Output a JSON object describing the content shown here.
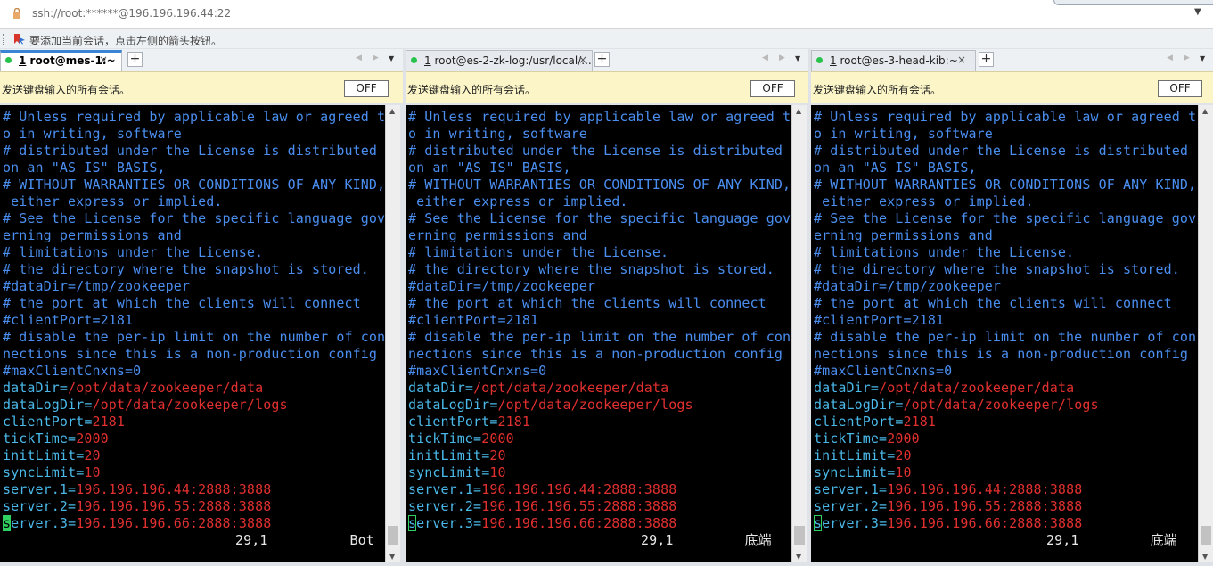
{
  "address_bar": {
    "url": "ssh://root:******@196.196.196.44:22"
  },
  "hint_bar": {
    "text": "要添加当前会话，点击左侧的箭头按钮。"
  },
  "panes": [
    {
      "tab": {
        "number": "1",
        "title": "root@mes-1:~",
        "active": true
      },
      "send_bar": {
        "text": "发送键盘输入的所有会话。",
        "toggle_label": "OFF"
      },
      "status": {
        "position": "29,1",
        "scroll": "Bot"
      },
      "cursor_style": "solid"
    },
    {
      "tab": {
        "number": "1",
        "title": "root@es-2-zk-log:/usr/local/...",
        "active": false
      },
      "send_bar": {
        "text": "发送键盘输入的所有会话。",
        "toggle_label": "OFF"
      },
      "status": {
        "position": "29,1",
        "scroll": "底端"
      },
      "cursor_style": "hollow"
    },
    {
      "tab": {
        "number": "1",
        "title": "root@es-3-head-kib:~",
        "active": false
      },
      "send_bar": {
        "text": "发送键盘输入的所有会话。",
        "toggle_label": "OFF"
      },
      "status": {
        "position": "29,1",
        "scroll": "底端"
      },
      "cursor_style": "hollow"
    }
  ],
  "terminal_lines": [
    [
      {
        "t": "# Unless required by applicable law or agreed t",
        "c": "blue"
      }
    ],
    [
      {
        "t": "o in writing, software",
        "c": "blue"
      }
    ],
    [
      {
        "t": "# distributed under the License is distributed",
        "c": "blue"
      }
    ],
    [
      {
        "t": "on an \"AS IS\" BASIS,",
        "c": "blue"
      }
    ],
    [
      {
        "t": "# WITHOUT WARRANTIES OR CONDITIONS OF ANY KIND,",
        "c": "blue"
      }
    ],
    [
      {
        "t": " either express or implied.",
        "c": "blue"
      }
    ],
    [
      {
        "t": "# See the License for the specific language gov",
        "c": "blue"
      }
    ],
    [
      {
        "t": "erning permissions and",
        "c": "blue"
      }
    ],
    [
      {
        "t": "# limitations under the License.",
        "c": "blue"
      }
    ],
    [
      {
        "t": "# the directory where the snapshot is stored.",
        "c": "blue"
      }
    ],
    [
      {
        "t": "#dataDir=/tmp/zookeeper",
        "c": "blue"
      }
    ],
    [
      {
        "t": "# the port at which the clients will connect",
        "c": "blue"
      }
    ],
    [
      {
        "t": "#clientPort=2181",
        "c": "blue"
      }
    ],
    [
      {
        "t": "# disable the per-ip limit on the number of con",
        "c": "blue"
      }
    ],
    [
      {
        "t": "nections since this is a non-production config",
        "c": "blue"
      }
    ],
    [
      {
        "t": "#maxClientCnxns=0",
        "c": "blue"
      }
    ],
    [
      {
        "t": "dataDir",
        "c": "cyan"
      },
      {
        "t": "=",
        "c": "cyan"
      },
      {
        "t": "/opt/data/zookeeper/data",
        "c": "red"
      }
    ],
    [
      {
        "t": "dataLogDir",
        "c": "cyan"
      },
      {
        "t": "=",
        "c": "cyan"
      },
      {
        "t": "/opt/data/zookeeper/logs",
        "c": "red"
      }
    ],
    [
      {
        "t": "clientPort",
        "c": "cyan"
      },
      {
        "t": "=",
        "c": "cyan"
      },
      {
        "t": "2181",
        "c": "red"
      }
    ],
    [
      {
        "t": "tickTime",
        "c": "cyan"
      },
      {
        "t": "=",
        "c": "cyan"
      },
      {
        "t": "2000",
        "c": "red"
      }
    ],
    [
      {
        "t": "initLimit",
        "c": "cyan"
      },
      {
        "t": "=",
        "c": "cyan"
      },
      {
        "t": "20",
        "c": "red"
      }
    ],
    [
      {
        "t": "syncLimit",
        "c": "cyan"
      },
      {
        "t": "=",
        "c": "cyan"
      },
      {
        "t": "10",
        "c": "red"
      }
    ],
    [
      {
        "t": "server.1",
        "c": "cyan"
      },
      {
        "t": "=",
        "c": "cyan"
      },
      {
        "t": "196.196.196.44:2888:3888",
        "c": "red"
      }
    ],
    [
      {
        "t": "server.2",
        "c": "cyan"
      },
      {
        "t": "=",
        "c": "cyan"
      },
      {
        "t": "196.196.196.55:2888:3888",
        "c": "red"
      }
    ],
    [
      {
        "t": "s",
        "c": "cursor"
      },
      {
        "t": "erver.3",
        "c": "cyan"
      },
      {
        "t": "=",
        "c": "cyan"
      },
      {
        "t": "196.196.196.66:2888:3888",
        "c": "red"
      }
    ]
  ],
  "colors": {
    "comment": "#4a8ef0",
    "key": "#4ab8e8",
    "value": "#e0302f",
    "cursor": "#2fd05f",
    "background": "#000000",
    "send_bar": "#fbf5c7",
    "active_tab_accent": "#3a84d6"
  },
  "icons": {
    "lock": "lock-icon",
    "bookmark": "bookmark-arrow-icon",
    "tab_status": "green-dot-icon",
    "close": "close-icon",
    "add": "plus-icon"
  }
}
